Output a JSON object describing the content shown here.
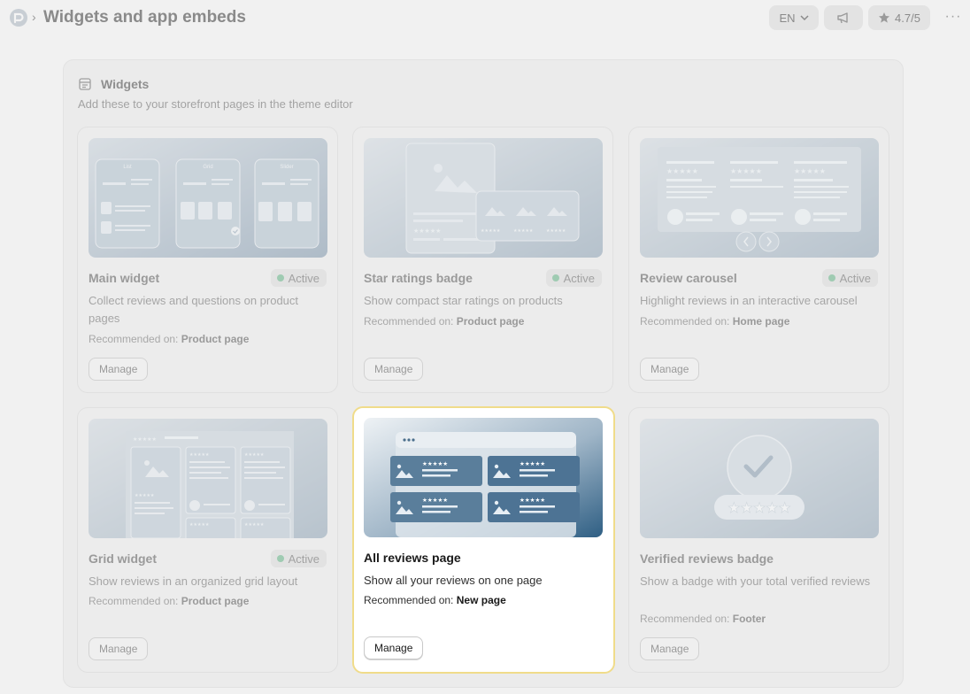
{
  "header": {
    "title": "Widgets and app embeds",
    "separator": "›",
    "language": "EN",
    "rating": "4.7/5",
    "more": "···"
  },
  "panel": {
    "title": "Widgets",
    "subtitle": "Add these to your storefront pages in the theme editor"
  },
  "cards": [
    {
      "title": "Main widget",
      "status": "Active",
      "description": "Collect reviews and questions on product pages",
      "rec_label": "Recommended on:",
      "rec_value": "Product page",
      "button": "Manage",
      "thumb_tabs": [
        "List",
        "Grid",
        "Slider"
      ]
    },
    {
      "title": "Star ratings badge",
      "status": "Active",
      "description": "Show compact star ratings on products",
      "rec_label": "Recommended on:",
      "rec_value": "Product page",
      "button": "Manage"
    },
    {
      "title": "Review carousel",
      "status": "Active",
      "description": "Highlight reviews in an interactive carousel",
      "rec_label": "Recommended on:",
      "rec_value": "Home page",
      "button": "Manage"
    },
    {
      "title": "Grid widget",
      "status": "Active",
      "description": "Show reviews in an organized grid layout",
      "rec_label": "Recommended on:",
      "rec_value": "Product page",
      "button": "Manage"
    },
    {
      "title": "All reviews page",
      "status": "",
      "description": "Show all your reviews on one page",
      "rec_label": "Recommended on:",
      "rec_value": "New page",
      "button": "Manage"
    },
    {
      "title": "Verified reviews badge",
      "status": "",
      "description": "Show a badge with your total verified reviews",
      "rec_label": "Recommended on:",
      "rec_value": "Footer",
      "button": "Manage"
    }
  ],
  "colors": {
    "highlight_border": "#f0dc8a",
    "active_dot": "#9fcbb2",
    "thumb_blue": "#2f5f84"
  }
}
